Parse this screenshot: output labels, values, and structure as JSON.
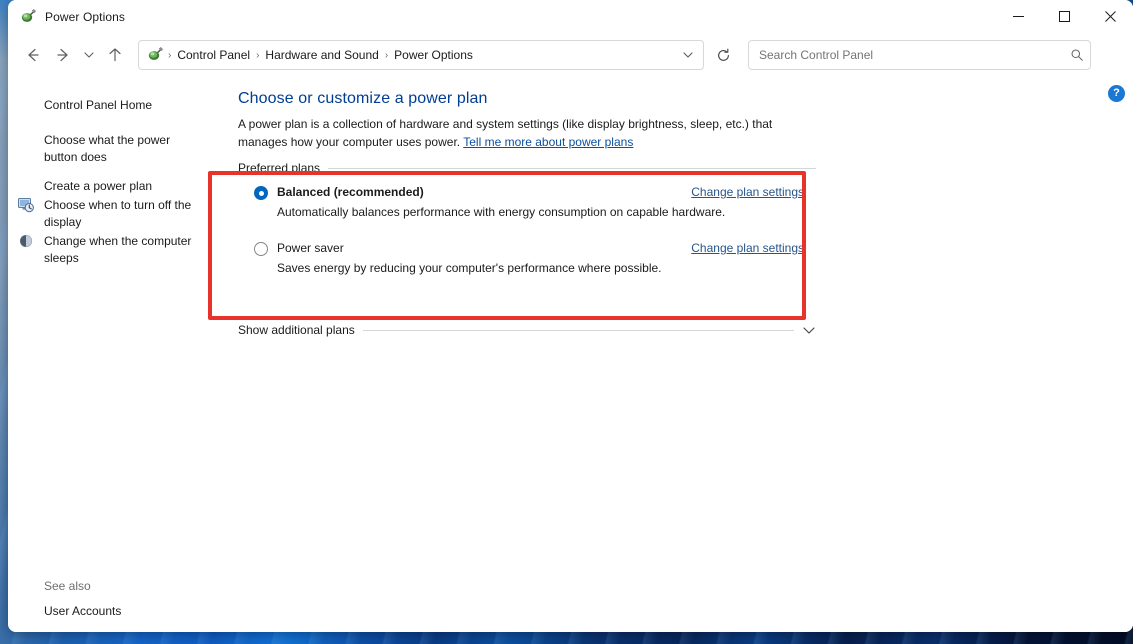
{
  "window": {
    "title": "Power Options",
    "icon": "power-plug-icon",
    "controls": {
      "minimize": "Minimize",
      "maximize": "Maximize",
      "close": "Close"
    }
  },
  "toolbar": {
    "back": "Back",
    "forward": "Forward",
    "recent_locations": "Recent locations",
    "up": "Up",
    "refresh": "Refresh",
    "breadcrumbs": [
      "Control Panel",
      "Hardware and Sound",
      "Power Options"
    ],
    "breadcrumb_separator": "›",
    "address_dropdown": "Previous locations"
  },
  "search": {
    "placeholder": "Search Control Panel",
    "value": "",
    "icon": "search-icon"
  },
  "sidebar": {
    "home": "Control Panel Home",
    "items": [
      {
        "label": "Choose what the power button does",
        "icon": ""
      },
      {
        "label": "Create a power plan",
        "icon": ""
      },
      {
        "label": "Choose when to turn off the display",
        "icon": "display-clock-icon"
      },
      {
        "label": "Change when the computer sleeps",
        "icon": "sleep-moon-icon"
      }
    ],
    "see_also_label": "See also",
    "see_also_items": [
      "User Accounts"
    ]
  },
  "main": {
    "title": "Choose or customize a power plan",
    "description_part1": "A power plan is a collection of hardware and system settings (like display brightness, sleep, etc.) that manages how your computer uses power. ",
    "description_link": "Tell me more about power plans",
    "group_label": "Preferred plans",
    "plans": [
      {
        "name": "Balanced (recommended)",
        "description": "Automatically balances performance with energy consumption on capable hardware.",
        "link": "Change plan settings",
        "selected": true
      },
      {
        "name": "Power saver",
        "description": "Saves energy by reducing your computer's performance where possible.",
        "link": "Change plan settings",
        "selected": false
      }
    ],
    "show_additional": "Show additional plans",
    "show_additional_icon": "chevron-down-icon",
    "help": "?"
  },
  "colors": {
    "accent": "#0067c0",
    "link": "#26558b",
    "title": "#003e92",
    "highlight": "#e8332a"
  }
}
